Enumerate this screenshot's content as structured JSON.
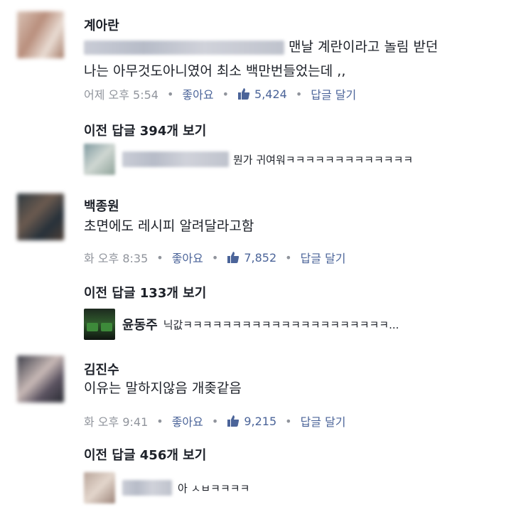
{
  "comments": [
    {
      "author": "계아란",
      "line1": "맨날 계란이라고 놀림 받던",
      "line2": "나는 아무것도아니였어 최소 백만번들었는데 ,,",
      "time": "어제 오후 5:54",
      "like_label": "좋아요",
      "like_count": "5,424",
      "reply_label": "답글 달기"
    },
    {
      "author": "백종원",
      "line1": "초면에도 레시피 알려달라고함",
      "time": "화 오후 8:35",
      "like_label": "좋아요",
      "like_count": "7,852",
      "reply_label": "답글 달기"
    },
    {
      "author": "김진수",
      "line1": "이유는 말하지않음 개좆같음",
      "time": "화 오후 9:41",
      "like_label": "좋아요",
      "like_count": "9,215",
      "reply_label": "답글 달기"
    }
  ],
  "previous_replies": [
    "이전 답글 394개 보기",
    "이전 답글 133개 보기",
    "이전 답글 456개 보기"
  ],
  "replies": [
    {
      "name": "",
      "text": "뭔가 귀여워ㅋㅋㅋㅋㅋㅋㅋㅋㅋㅋㅋㅋㅋ"
    },
    {
      "name": "윤동주",
      "text": "닉값ㅋㅋㅋㅋㅋㅋㅋㅋㅋㅋㅋㅋㅋㅋㅋㅋㅋㅋㅋㅋㅋ..."
    },
    {
      "name": "",
      "text": "아 ㅅㅂㅋㅋㅋㅋ"
    }
  ],
  "colors": {
    "text": "#1d2129",
    "meta": "#90949c",
    "link": "#4b6499"
  },
  "icons": {
    "like": "thumbs-up-icon"
  }
}
